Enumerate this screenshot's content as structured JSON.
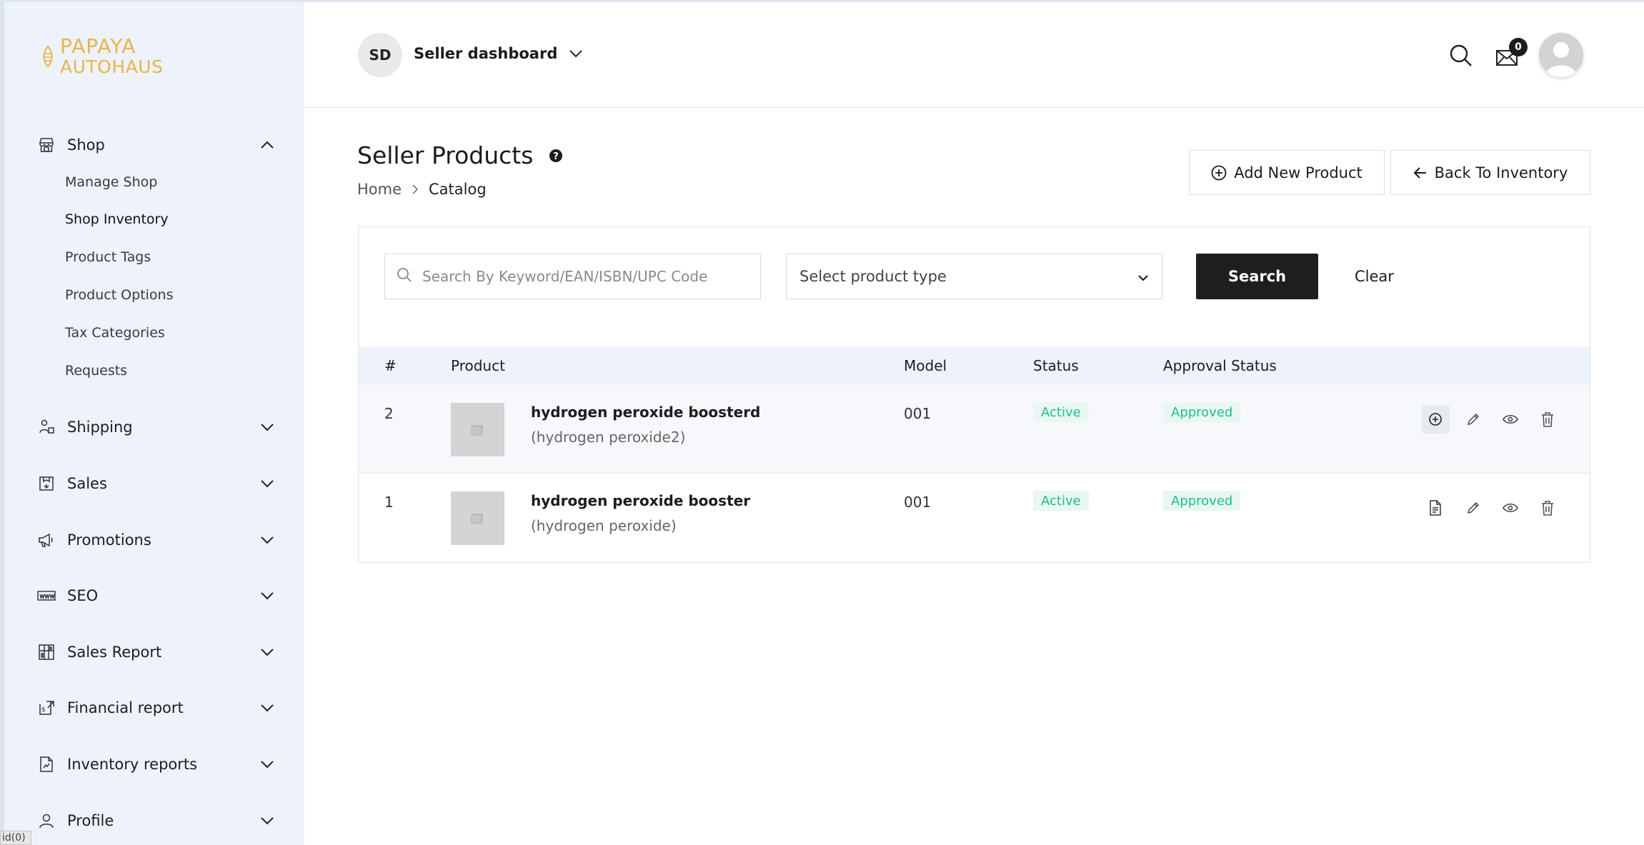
{
  "brand": {
    "line1": "PAPAYA",
    "line2": "AUTOHAUS",
    "color": "#e8b54a"
  },
  "sidebar": {
    "sections": [
      {
        "label": "Shop",
        "icon": "store-icon",
        "expanded": true
      },
      {
        "label": "Shipping",
        "icon": "shipping-icon",
        "expanded": false
      },
      {
        "label": "Sales",
        "icon": "sales-icon",
        "expanded": false
      },
      {
        "label": "Promotions",
        "icon": "megaphone-icon",
        "expanded": false
      },
      {
        "label": "SEO",
        "icon": "www-icon",
        "expanded": false
      },
      {
        "label": "Sales Report",
        "icon": "report-grid-icon",
        "expanded": false
      },
      {
        "label": "Financial report",
        "icon": "financial-icon",
        "expanded": false
      },
      {
        "label": "Inventory reports",
        "icon": "inventory-report-icon",
        "expanded": false
      },
      {
        "label": "Profile",
        "icon": "person-icon",
        "expanded": false
      }
    ],
    "shop_items": [
      "Manage Shop",
      "Shop Inventory",
      "Product Tags",
      "Product Options",
      "Tax Categories",
      "Requests"
    ],
    "active_item": "Shop Inventory",
    "footer_text": "id(0)"
  },
  "header": {
    "initials": "SD",
    "dashboard_label": "Seller dashboard",
    "mail_count": "0"
  },
  "page": {
    "title": "Seller Products",
    "breadcrumb": {
      "home": "Home",
      "current": "Catalog"
    },
    "add_button": "Add New Product",
    "back_button": "Back To Inventory"
  },
  "filters": {
    "search_placeholder": "Search By Keyword/EAN/ISBN/UPC Code",
    "product_type_label": "Select product type",
    "search_button": "Search",
    "clear_button": "Clear"
  },
  "table": {
    "columns": [
      "#",
      "Product",
      "Model",
      "Status",
      "Approval Status"
    ],
    "rows": [
      {
        "num": "2",
        "name": "hydrogen peroxide boosterd",
        "sub": "(hydrogen peroxide2)",
        "model": "001",
        "status": "Active",
        "approval": "Approved",
        "first_action": "plus-circle-icon"
      },
      {
        "num": "1",
        "name": "hydrogen peroxide booster",
        "sub": "(hydrogen peroxide)",
        "model": "001",
        "status": "Active",
        "approval": "Approved",
        "first_action": "document-icon"
      }
    ]
  },
  "colors": {
    "sidebar_bg": "#edf2fb",
    "status_green": "#1fbf8a",
    "status_bg": "#e8f7f1",
    "primary_btn": "#1e1e1e"
  }
}
